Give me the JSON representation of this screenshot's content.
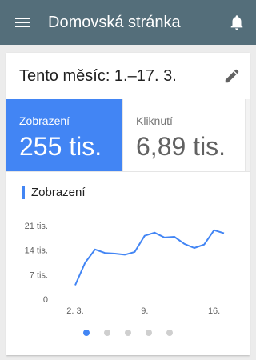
{
  "appbar": {
    "title": "Domovská stránka",
    "menu_icon": "menu-icon",
    "notification_icon": "bell-icon"
  },
  "card": {
    "period": "Tento měsíc: 1.–17. 3.",
    "edit_icon": "pencil-icon"
  },
  "metrics": [
    {
      "label": "Zobrazení",
      "value": "255 tis.",
      "selected": true
    },
    {
      "label": "Kliknutí",
      "value": "6,89 tis.",
      "selected": false
    }
  ],
  "chart_data": {
    "type": "line",
    "title": "Zobrazení",
    "xlabel": "",
    "ylabel": "",
    "x_ticks": [
      {
        "day": 2,
        "label": "2. 3."
      },
      {
        "day": 9,
        "label": "9."
      },
      {
        "day": 16,
        "label": "16."
      }
    ],
    "y_ticks": [
      {
        "value": 0,
        "label": "0"
      },
      {
        "value": 7000,
        "label": "7 tis."
      },
      {
        "value": 14000,
        "label": "14 tis."
      },
      {
        "value": 21000,
        "label": "21 tis."
      }
    ],
    "xlim": [
      2,
      17
    ],
    "ylim": [
      0,
      21000
    ],
    "grid": false,
    "series": [
      {
        "color": "#4285f4",
        "x": [
          2,
          3,
          4,
          5,
          6,
          7,
          8,
          9,
          10,
          11,
          12,
          13,
          14,
          15,
          16,
          17
        ],
        "y": [
          4000,
          10400,
          14200,
          13200,
          13000,
          12700,
          13500,
          18100,
          19000,
          17600,
          17800,
          15800,
          14600,
          15600,
          19700,
          18800
        ]
      }
    ]
  },
  "pager": {
    "count": 5,
    "active_index": 0
  },
  "colors": {
    "appbar": "#546e7a",
    "accent": "#4285f4"
  }
}
